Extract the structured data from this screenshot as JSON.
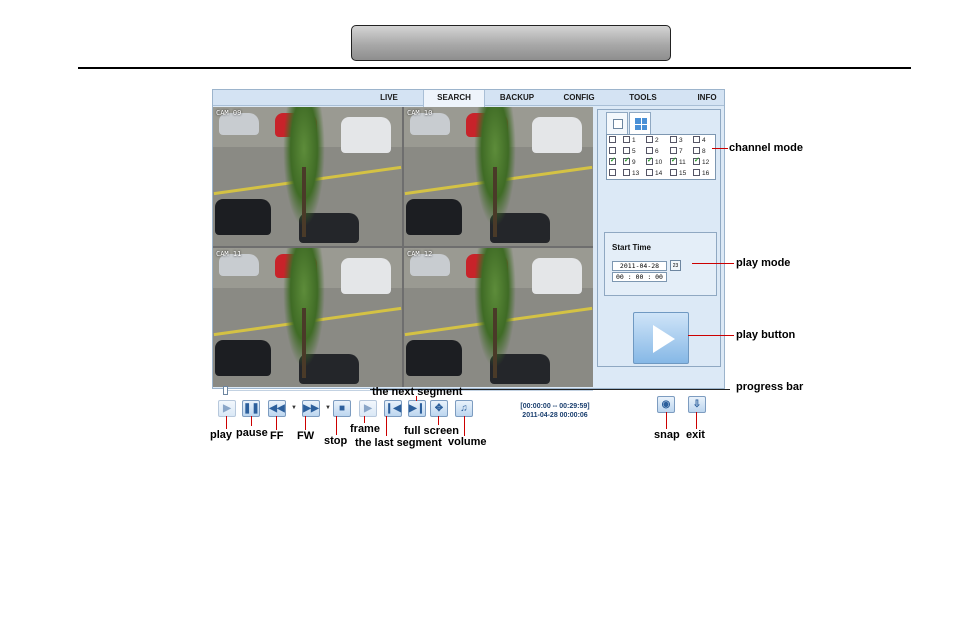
{
  "nav": {
    "tabs": [
      {
        "label": "LIVE"
      },
      {
        "label": "SEARCH",
        "active": true
      },
      {
        "label": "BACKUP"
      },
      {
        "label": "CONFIG"
      },
      {
        "label": "TOOLS"
      },
      {
        "label": "INFO"
      }
    ]
  },
  "cameras": [
    {
      "label": "CAM 09"
    },
    {
      "label": "CAM 10"
    },
    {
      "label": "CAM 11"
    },
    {
      "label": "CAM 12"
    }
  ],
  "channels": {
    "rows": [
      {
        "all": false,
        "items": [
          {
            "n": "1",
            "on": false
          },
          {
            "n": "2",
            "on": false
          },
          {
            "n": "3",
            "on": false
          },
          {
            "n": "4",
            "on": false
          }
        ]
      },
      {
        "all": false,
        "items": [
          {
            "n": "5",
            "on": false
          },
          {
            "n": "6",
            "on": false
          },
          {
            "n": "7",
            "on": false
          },
          {
            "n": "8",
            "on": false
          }
        ]
      },
      {
        "all": true,
        "items": [
          {
            "n": "9",
            "on": true
          },
          {
            "n": "10",
            "on": true
          },
          {
            "n": "11",
            "on": true
          },
          {
            "n": "12",
            "on": true
          }
        ]
      },
      {
        "all": false,
        "items": [
          {
            "n": "13",
            "on": false
          },
          {
            "n": "14",
            "on": false
          },
          {
            "n": "15",
            "on": false
          },
          {
            "n": "16",
            "on": false
          }
        ]
      }
    ]
  },
  "start": {
    "title": "Start Time",
    "date": "2011-04-28",
    "time": "00 : 00 : 00",
    "calendar_label": "23"
  },
  "playback": {
    "range": "[00:00:00 -- 00:29:59]",
    "current": "2011-04-28 00:00:06",
    "progress": 0.0
  },
  "annotations": {
    "channel_mode": "channel mode",
    "play_mode": "play mode",
    "play_button": "play button",
    "progress_bar": "progress bar",
    "next_segment": "the next segment",
    "play": "play",
    "pause": "pause",
    "ff": "FF",
    "fw": "FW",
    "stop": "stop",
    "frame": "frame",
    "last_segment": "the last segment",
    "full_screen": "full screen",
    "volume": "volume",
    "snap": "snap",
    "exit": "exit"
  },
  "icons": {
    "play": "play-icon",
    "pause": "pause-icon",
    "ff": "rewind-icon",
    "fw": "fast-forward-icon",
    "stop": "stop-icon",
    "frame": "frame-step-icon",
    "last": "previous-segment-icon",
    "next": "next-segment-icon",
    "fullscreen": "fullscreen-icon",
    "volume": "volume-icon",
    "snap": "camera-icon",
    "exit": "exit-icon"
  },
  "colors": {
    "panel_bg": "#dce9f6",
    "accent": "#4a90d6",
    "leader_line": "#cc0000"
  }
}
